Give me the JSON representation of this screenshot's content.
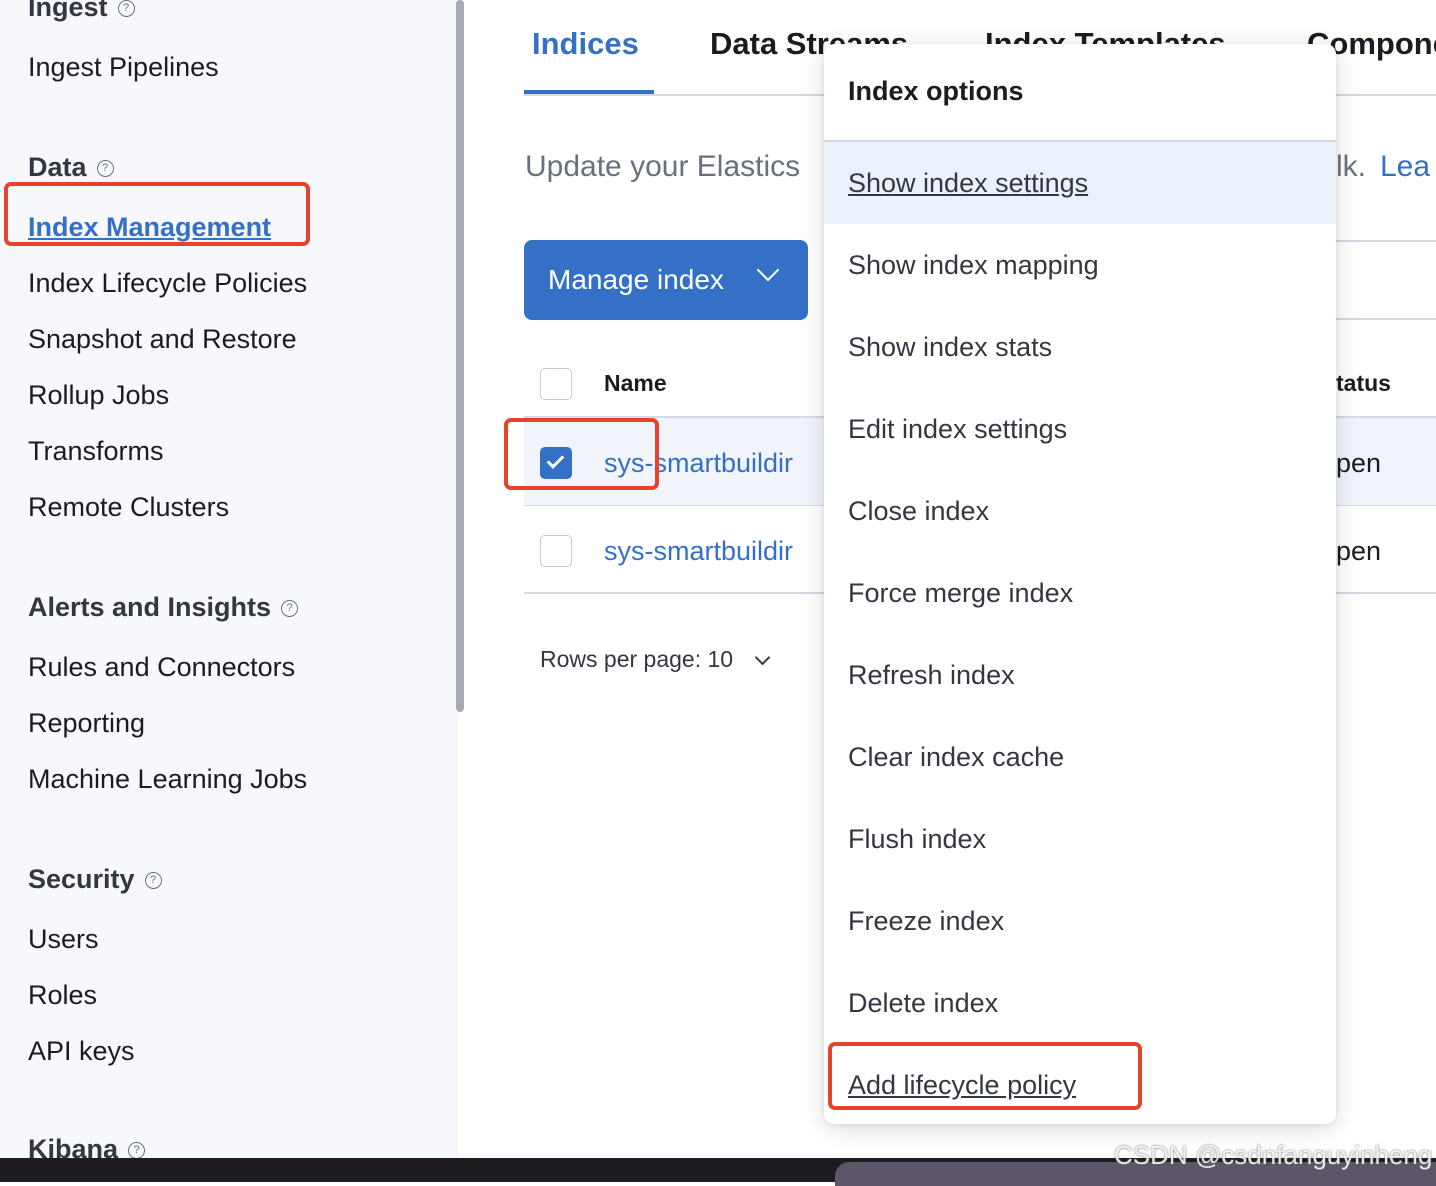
{
  "sidebar": {
    "ingest_heading": "Ingest",
    "ingest_items": [
      "Ingest Pipelines"
    ],
    "data_heading": "Data",
    "data_items": [
      "Index Management",
      "Index Lifecycle Policies",
      "Snapshot and Restore",
      "Rollup Jobs",
      "Transforms",
      "Remote Clusters"
    ],
    "alerts_heading": "Alerts and Insights",
    "alerts_items": [
      "Rules and Connectors",
      "Reporting",
      "Machine Learning Jobs"
    ],
    "security_heading": "Security",
    "security_items": [
      "Users",
      "Roles",
      "API keys"
    ],
    "kibana_heading": "Kibana",
    "help_icon": "?"
  },
  "tabs": [
    "Indices",
    "Data Streams",
    "Index Templates",
    "Component"
  ],
  "intro": {
    "text": "Update your Elastics",
    "text_right": "lk.",
    "link": "Lea"
  },
  "manage_button": "Manage index",
  "table": {
    "header_name": "Name",
    "header_status": "tatus",
    "rows": [
      {
        "name": "sys-smartbuildir",
        "status": "pen",
        "checked": true
      },
      {
        "name": "sys-smartbuildir",
        "status": "pen",
        "checked": false
      }
    ]
  },
  "pagination": {
    "rows_per_page": "Rows per page: 10"
  },
  "menu": {
    "title": "Index options",
    "items": [
      "Show index settings",
      "Show index mapping",
      "Show index stats",
      "Edit index settings",
      "Close index",
      "Force merge index",
      "Refresh index",
      "Clear index cache",
      "Flush index",
      "Freeze index",
      "Delete index",
      "Add lifecycle policy"
    ]
  },
  "watermark": "CSDN @csdnfanguyinheng",
  "colors": {
    "accent": "#3470c6",
    "highlight": "#e5432b"
  }
}
